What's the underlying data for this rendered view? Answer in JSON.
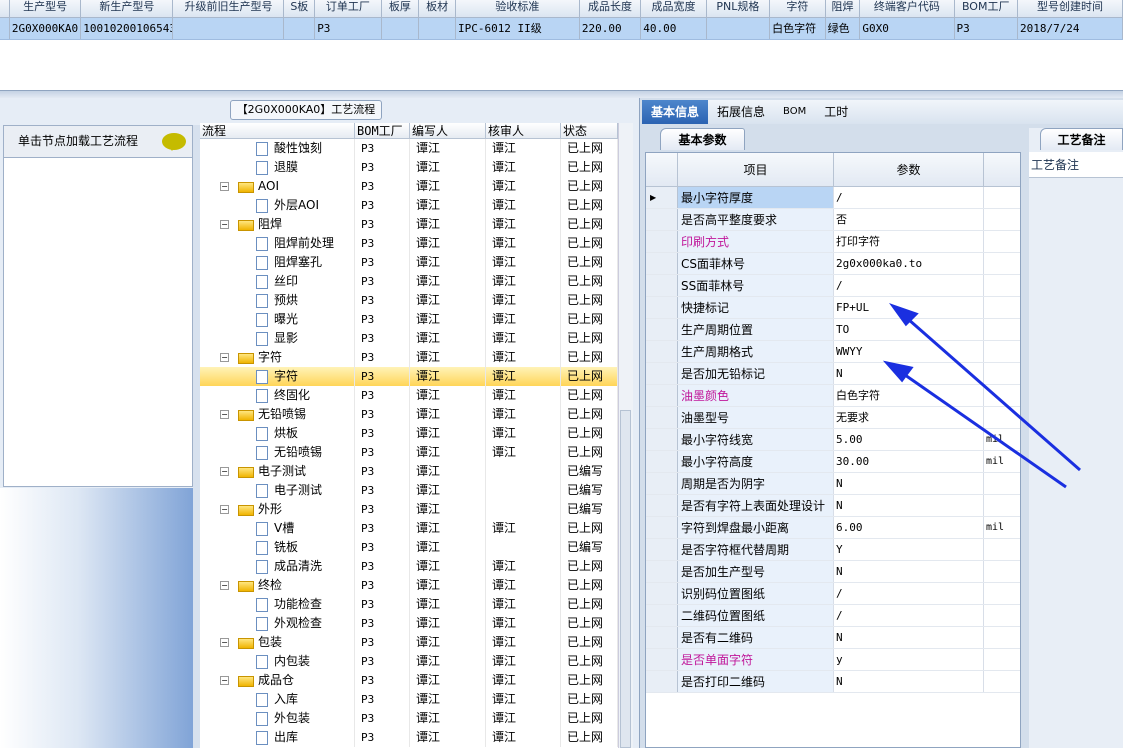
{
  "top_table": {
    "headers": [
      "生产型号",
      "新生产型号",
      "升级前旧生产型号",
      "S板",
      "订单工厂",
      "板厚",
      "板材",
      "验收标准",
      "成品长度",
      "成品宽度",
      "PNL规格",
      "字符",
      "阻焊",
      "终端客户代码",
      "BOM工厂",
      "型号创建时间"
    ],
    "row": [
      "2G0X000KA0",
      "10010200106543",
      "",
      "",
      "P3",
      "",
      "",
      "IPC-6012 II级",
      "220.00",
      "40.00",
      "",
      "白色字符",
      "绿色",
      "G0X0",
      "P3",
      "2018/7/24"
    ]
  },
  "flow_title": "【2G0X000KA0】工艺流程",
  "side": {
    "hint": "单击节点加载工艺流程"
  },
  "tree": {
    "headers": [
      "流程",
      "BOM工厂",
      "编写人",
      "核审人",
      "状态"
    ],
    "rows": [
      {
        "name": "酸性蚀刻",
        "type": "doc",
        "bom": "P3",
        "writer": "谭江",
        "reviewer": "谭江",
        "status": "已上网"
      },
      {
        "name": "退膜",
        "type": "doc",
        "bom": "P3",
        "writer": "谭江",
        "reviewer": "谭江",
        "status": "已上网"
      },
      {
        "name": "AOI",
        "type": "folder",
        "bom": "P3",
        "writer": "谭江",
        "reviewer": "谭江",
        "status": "已上网"
      },
      {
        "name": "外层AOI",
        "type": "doc",
        "bom": "P3",
        "writer": "谭江",
        "reviewer": "谭江",
        "status": "已上网"
      },
      {
        "name": "阻焊",
        "type": "folder",
        "bom": "P3",
        "writer": "谭江",
        "reviewer": "谭江",
        "status": "已上网"
      },
      {
        "name": "阻焊前处理",
        "type": "doc",
        "bom": "P3",
        "writer": "谭江",
        "reviewer": "谭江",
        "status": "已上网"
      },
      {
        "name": "阻焊塞孔",
        "type": "doc",
        "bom": "P3",
        "writer": "谭江",
        "reviewer": "谭江",
        "status": "已上网"
      },
      {
        "name": "丝印",
        "type": "doc",
        "bom": "P3",
        "writer": "谭江",
        "reviewer": "谭江",
        "status": "已上网"
      },
      {
        "name": "预烘",
        "type": "doc",
        "bom": "P3",
        "writer": "谭江",
        "reviewer": "谭江",
        "status": "已上网"
      },
      {
        "name": "曝光",
        "type": "doc",
        "bom": "P3",
        "writer": "谭江",
        "reviewer": "谭江",
        "status": "已上网"
      },
      {
        "name": "显影",
        "type": "doc",
        "bom": "P3",
        "writer": "谭江",
        "reviewer": "谭江",
        "status": "已上网"
      },
      {
        "name": "字符",
        "type": "folder",
        "bom": "P3",
        "writer": "谭江",
        "reviewer": "谭江",
        "status": "已上网"
      },
      {
        "name": "字符",
        "type": "doc",
        "bom": "P3",
        "writer": "谭江",
        "reviewer": "谭江",
        "status": "已上网",
        "selected": true
      },
      {
        "name": "终固化",
        "type": "doc",
        "bom": "P3",
        "writer": "谭江",
        "reviewer": "谭江",
        "status": "已上网"
      },
      {
        "name": "无铅喷锡",
        "type": "folder",
        "bom": "P3",
        "writer": "谭江",
        "reviewer": "谭江",
        "status": "已上网"
      },
      {
        "name": "烘板",
        "type": "doc",
        "bom": "P3",
        "writer": "谭江",
        "reviewer": "谭江",
        "status": "已上网"
      },
      {
        "name": "无铅喷锡",
        "type": "doc",
        "bom": "P3",
        "writer": "谭江",
        "reviewer": "谭江",
        "status": "已上网"
      },
      {
        "name": "电子测试",
        "type": "folder",
        "bom": "P3",
        "writer": "谭江",
        "reviewer": "",
        "status": "已编写"
      },
      {
        "name": "电子测试",
        "type": "doc",
        "bom": "P3",
        "writer": "谭江",
        "reviewer": "",
        "status": "已编写"
      },
      {
        "name": "外形",
        "type": "folder",
        "bom": "P3",
        "writer": "谭江",
        "reviewer": "",
        "status": "已编写"
      },
      {
        "name": "V槽",
        "type": "doc",
        "bom": "P3",
        "writer": "谭江",
        "reviewer": "谭江",
        "status": "已上网"
      },
      {
        "name": "铣板",
        "type": "doc",
        "bom": "P3",
        "writer": "谭江",
        "reviewer": "",
        "status": "已编写"
      },
      {
        "name": "成品清洗",
        "type": "doc",
        "bom": "P3",
        "writer": "谭江",
        "reviewer": "谭江",
        "status": "已上网"
      },
      {
        "name": "终检",
        "type": "folder",
        "bom": "P3",
        "writer": "谭江",
        "reviewer": "谭江",
        "status": "已上网"
      },
      {
        "name": "功能检查",
        "type": "doc",
        "bom": "P3",
        "writer": "谭江",
        "reviewer": "谭江",
        "status": "已上网"
      },
      {
        "name": "外观检查",
        "type": "doc",
        "bom": "P3",
        "writer": "谭江",
        "reviewer": "谭江",
        "status": "已上网"
      },
      {
        "name": "包装",
        "type": "folder",
        "bom": "P3",
        "writer": "谭江",
        "reviewer": "谭江",
        "status": "已上网"
      },
      {
        "name": "内包装",
        "type": "doc",
        "bom": "P3",
        "writer": "谭江",
        "reviewer": "谭江",
        "status": "已上网"
      },
      {
        "name": "成品仓",
        "type": "folder",
        "bom": "P3",
        "writer": "谭江",
        "reviewer": "谭江",
        "status": "已上网"
      },
      {
        "name": "入库",
        "type": "doc",
        "bom": "P3",
        "writer": "谭江",
        "reviewer": "谭江",
        "status": "已上网"
      },
      {
        "name": "外包装",
        "type": "doc",
        "bom": "P3",
        "writer": "谭江",
        "reviewer": "谭江",
        "status": "已上网"
      },
      {
        "name": "出库",
        "type": "doc",
        "bom": "P3",
        "writer": "谭江",
        "reviewer": "谭江",
        "status": "已上网"
      }
    ]
  },
  "tabs": [
    "基本信息",
    "拓展信息",
    "BOM",
    "工时"
  ],
  "subtab": "基本参数",
  "params": {
    "headers": [
      "项目",
      "参数"
    ],
    "rows": [
      {
        "item": "最小字符厚度",
        "value": "/",
        "unit": ""
      },
      {
        "item": "是否高平整度要求",
        "value": "否",
        "unit": ""
      },
      {
        "item": "印刷方式",
        "value": "打印字符",
        "unit": "",
        "highlight": true
      },
      {
        "item": "CS面菲林号",
        "value": "2g0x000ka0.to",
        "unit": ""
      },
      {
        "item": "SS面菲林号",
        "value": "/",
        "unit": ""
      },
      {
        "item": "快捷标记",
        "value": "FP+UL",
        "unit": ""
      },
      {
        "item": "生产周期位置",
        "value": "TO",
        "unit": ""
      },
      {
        "item": "生产周期格式",
        "value": "WWYY",
        "unit": ""
      },
      {
        "item": "是否加无铅标记",
        "value": "N",
        "unit": ""
      },
      {
        "item": "油墨颜色",
        "value": "白色字符",
        "unit": "",
        "highlight": true
      },
      {
        "item": "油墨型号",
        "value": "无要求",
        "unit": ""
      },
      {
        "item": "最小字符线宽",
        "value": "5.00",
        "unit": "mil"
      },
      {
        "item": "最小字符高度",
        "value": "30.00",
        "unit": "mil"
      },
      {
        "item": "周期是否为阴字",
        "value": "N",
        "unit": ""
      },
      {
        "item": "是否有字符上表面处理设计",
        "value": "N",
        "unit": ""
      },
      {
        "item": "字符到焊盘最小距离",
        "value": "6.00",
        "unit": "mil"
      },
      {
        "item": "是否字符框代替周期",
        "value": "Y",
        "unit": ""
      },
      {
        "item": "是否加生产型号",
        "value": "N",
        "unit": ""
      },
      {
        "item": "识别码位置图纸",
        "value": "/",
        "unit": ""
      },
      {
        "item": "二维码位置图纸",
        "value": "/",
        "unit": ""
      },
      {
        "item": "是否有二维码",
        "value": "N",
        "unit": ""
      },
      {
        "item": "是否单面字符",
        "value": "y",
        "unit": "",
        "highlight": true
      },
      {
        "item": "是否打印二维码",
        "value": "N",
        "unit": ""
      }
    ]
  },
  "notes": {
    "tab": "工艺备注",
    "label": "工艺备注"
  },
  "colors": {
    "selection": "#b9d5f4",
    "active_tab": "#2b63b2",
    "highlight_label": "#c0169a",
    "arrow": "#1a2fe0",
    "selected_row": "#ffd558"
  }
}
